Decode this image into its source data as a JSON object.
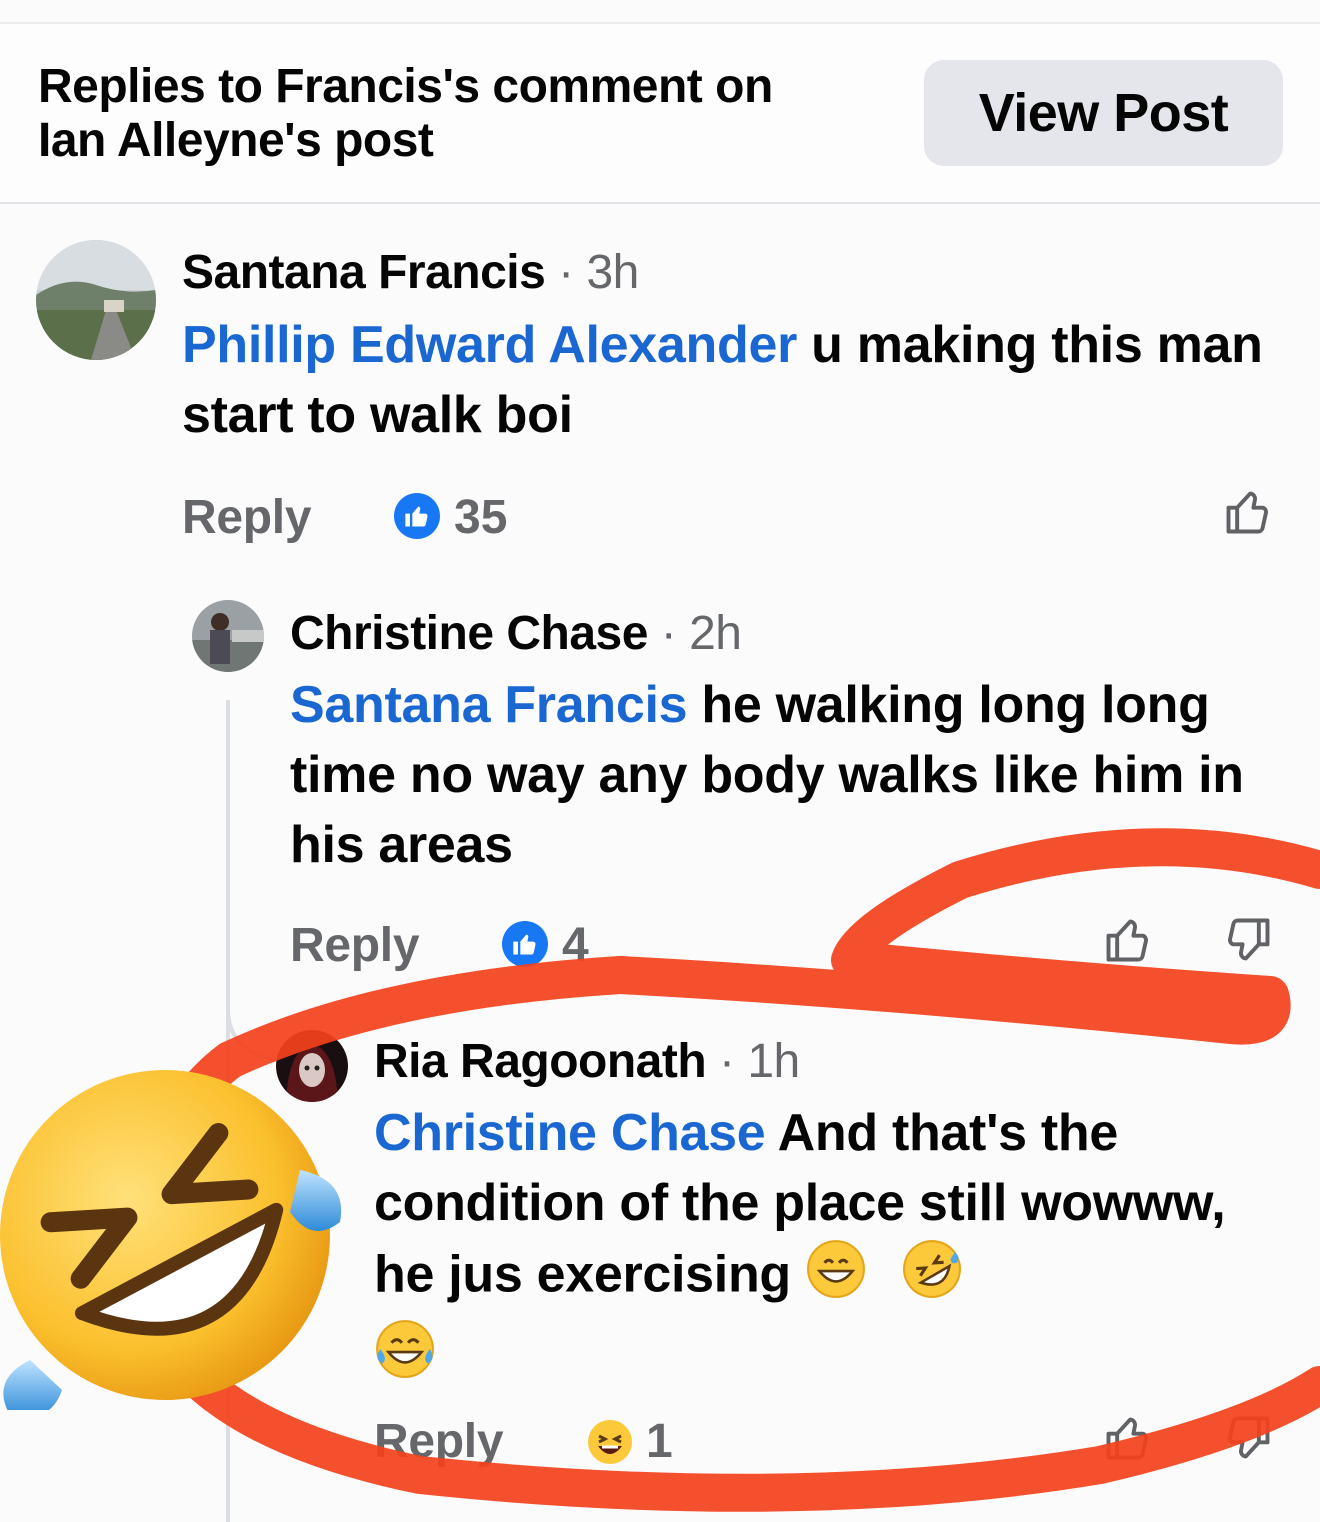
{
  "header": {
    "title_line1": "Replies to Francis's comment on",
    "title_line2": "Ian Alleyne's post",
    "view_post_label": "View Post"
  },
  "comments": [
    {
      "author": "Santana Francis",
      "time": " · 3h",
      "mention": "Phillip Edward Alexander",
      "text": "  u making this man start to walk boi",
      "reply_label": "Reply",
      "reaction_count": "35"
    },
    {
      "author": "Christine Chase",
      "time": " · 2h",
      "mention": "Santana Francis",
      "text": " he walking long long time no way any body walks like him in his areas",
      "reply_label": "Reply",
      "reaction_count": "4"
    },
    {
      "author": "Ria Ragoonath",
      "time": " · 1h",
      "mention": "Christine Chase",
      "text": " And that's the condition of the place still wowww, he jus exercising",
      "reply_label": "Reply",
      "reaction_count": "1"
    }
  ],
  "icons": {
    "like": "thumbs-up-icon",
    "dislike": "thumbs-down-icon",
    "like_reaction": "like-reaction-icon",
    "haha_reaction": "haha-reaction-icon",
    "overlay": "rofl-emoji-icon"
  },
  "colors": {
    "mention": "#1a67d2",
    "like_blue": "#1877f2",
    "annotation": "#f4411c"
  }
}
